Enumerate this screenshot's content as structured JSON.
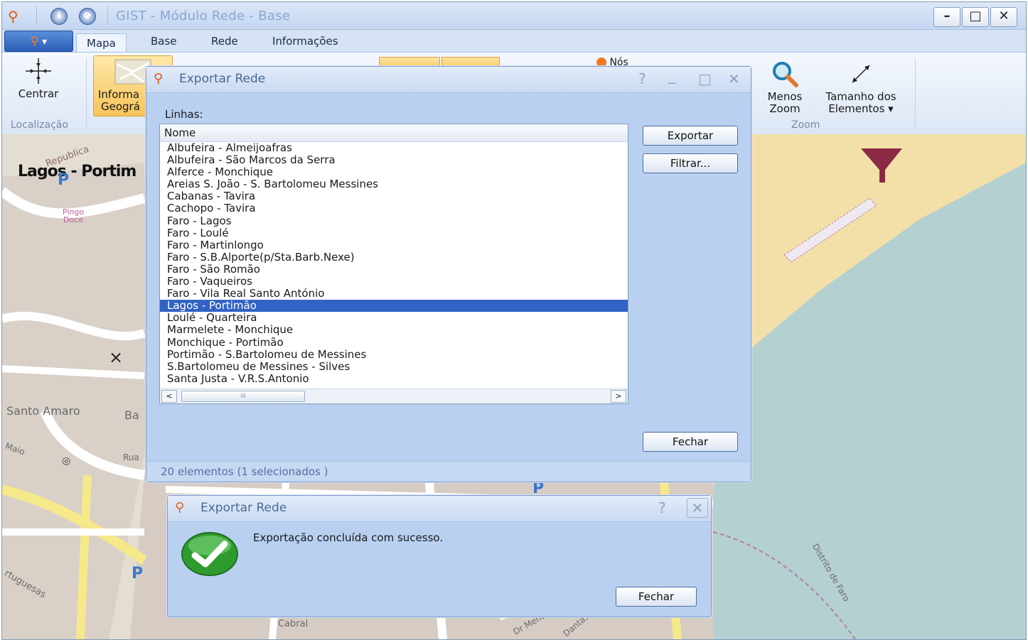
{
  "window": {
    "title": "GIST - Módulo Rede - Base",
    "minimize": "–",
    "maximize": "□",
    "close": "✕"
  },
  "ribbon": {
    "menu_button": "▾",
    "tabs": [
      {
        "label": "Mapa",
        "active": true
      },
      {
        "label": "Base",
        "active": false
      },
      {
        "label": "Rede",
        "active": false
      },
      {
        "label": "Informações",
        "active": false
      }
    ],
    "items": {
      "centrar": "Centrar",
      "info_geo_line1": "Informa",
      "info_geo_line2": "Geográ",
      "nos": "Nós",
      "menos_zoom_line1": "Menos",
      "menos_zoom_line2": "Zoom",
      "tamanho_line1": "Tamanho dos",
      "tamanho_line2": "Elementos ▾"
    },
    "groups": {
      "localizacao": "Localização",
      "zoom": "Zoom"
    }
  },
  "map": {
    "labels": {
      "lagos": "Lagos - Portim",
      "republica": "Republica",
      "pingo_doce": "Pingo Doce",
      "santo_amaro": "Santo Amaro",
      "ba": "Ba",
      "maio": "Maio",
      "rua": "Rua",
      "portuguesas": "rtuguesas",
      "cabral": "Cabral",
      "distrito": "Distrito de Faro",
      "dr_mendo": "Dr Mendo",
      "dantas": "Dantas",
      "parking": "P"
    },
    "colors": {
      "sea": "#b5d0d0",
      "beach": "#f3e0a8",
      "road": "#ffffff",
      "main_road": "#f5e98a",
      "built": "#d9cfc7"
    }
  },
  "export_dialog": {
    "title": "Exportar Rede",
    "help": "?",
    "minimize": "_",
    "maximize": "□",
    "close": "✕",
    "lines_label": "Linhas:",
    "column_header": "Nome",
    "rows": [
      "Albufeira - Almeijoafras",
      "Albufeira - São Marcos da Serra",
      "Alferce - Monchique",
      "Areias S. João - S. Bartolomeu Messines",
      "Cabanas - Tavira",
      "Cachopo - Tavira",
      "Faro - Lagos",
      "Faro - Loulé",
      "Faro - Martinlongo",
      "Faro - S.B.Alporte(p/Sta.Barb.Nexe)",
      "Faro - São Romão",
      "Faro - Vaqueiros",
      "Faro - Vila Real Santo António",
      "Lagos - Portimão",
      "Loulé - Quarteira",
      "Marmelete - Monchique",
      "Monchique - Portimão",
      "Portimão - S.Bartolomeu de Messines",
      "S.Bartolomeu de Messines - Silves",
      "Santa Justa - V.R.S.Antonio"
    ],
    "selected_index": 13,
    "buttons": {
      "exportar": "Exportar",
      "filtrar": "Filtrar...",
      "fechar": "Fechar"
    },
    "scroll_left": "<",
    "scroll_right": ">",
    "scroll_grip": "III",
    "status": "20 elementos (1 selecionados )"
  },
  "success_dialog": {
    "title": "Exportar Rede",
    "help": "?",
    "close": "✕",
    "message": "Exportação concluída com sucesso.",
    "fechar": "Fechar"
  }
}
